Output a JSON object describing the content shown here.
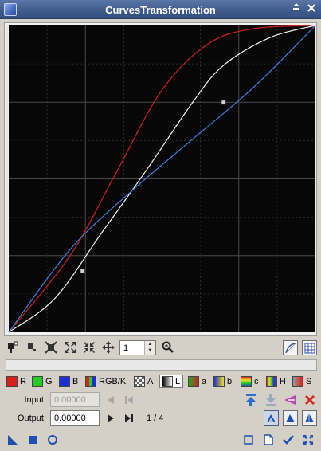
{
  "window": {
    "title": "CurvesTransformation"
  },
  "toolbar": {
    "zoom_value": "1"
  },
  "channels": {
    "items": [
      {
        "label": "R",
        "color": "#e0201c",
        "active": false
      },
      {
        "label": "G",
        "color": "#22cc22",
        "active": false
      },
      {
        "label": "B",
        "color": "#1a2fd6",
        "active": false
      },
      {
        "label": "RGB/K",
        "color": "#888888",
        "active": false
      },
      {
        "label": "A",
        "color": "#ffffff",
        "active": false
      },
      {
        "label": "L",
        "color": "#ffffff",
        "active": true
      },
      {
        "label": "a",
        "color": "#cc4422",
        "active": false
      },
      {
        "label": "b",
        "color": "#3344cc",
        "active": false
      },
      {
        "label": "c",
        "color": "#aa7733",
        "active": false
      },
      {
        "label": "H",
        "color": "#cc3333",
        "active": false
      },
      {
        "label": "S",
        "color": "#aa66cc",
        "active": false
      }
    ]
  },
  "input": {
    "label": "Input:",
    "value": "0.00000"
  },
  "output": {
    "label": "Output:",
    "value": "0.00000"
  },
  "point_counter": "1 / 4",
  "colors": {
    "curve_red": "#d11e1e",
    "curve_blue": "#3a7ee0",
    "curve_white": "#f4f4f4",
    "graph_bg": "#070707",
    "grid": "#5a5a5a",
    "title_bar": "#3e5a8e"
  },
  "chart_data": {
    "type": "line",
    "xlim": [
      0,
      1
    ],
    "ylim": [
      0,
      1
    ],
    "grid": "dotted, 4x4 major with minor subdivisions",
    "series": [
      {
        "color": "#d11e1e",
        "x": [
          0,
          0.2,
          0.35,
          0.5,
          0.65,
          0.8,
          1
        ],
        "y": [
          0,
          0.25,
          0.52,
          0.79,
          0.94,
          0.99,
          1
        ]
      },
      {
        "color": "#f4f4f4",
        "x": [
          0,
          0.15,
          0.3,
          0.45,
          0.6,
          0.7,
          0.85,
          1
        ],
        "y": [
          0,
          0.11,
          0.32,
          0.53,
          0.75,
          0.87,
          0.96,
          1
        ]
      },
      {
        "color": "#3a7ee0",
        "x": [
          0,
          0.2,
          0.4,
          0.6,
          0.8,
          1
        ],
        "y": [
          0,
          0.27,
          0.46,
          0.63,
          0.8,
          1
        ]
      }
    ],
    "control_points": [
      {
        "x": 0.24,
        "y": 0.2
      },
      {
        "x": 0.7,
        "y": 0.75
      }
    ]
  }
}
